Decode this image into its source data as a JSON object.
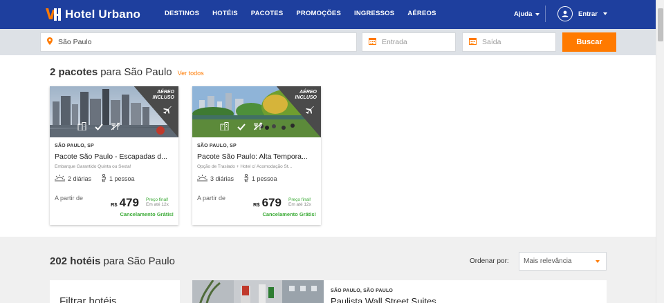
{
  "header": {
    "brand": "Hotel Urbano",
    "nav": [
      "DESTINOS",
      "HOTÉIS",
      "PACOTES",
      "PROMOÇÕES",
      "INGRESSOS",
      "AÉREOS"
    ],
    "help_label": "Ajuda",
    "login_label": "Entrar",
    "bg_color": "#1e3f9e"
  },
  "search": {
    "destination_value": "São Paulo",
    "checkin_placeholder": "Entrada",
    "checkout_placeholder": "Saída",
    "button_label": "Buscar",
    "accent_color": "#ff7a00"
  },
  "packages": {
    "count": "2 pacotes",
    "title_suffix": "para São Paulo",
    "see_all": "Ver todos",
    "items": [
      {
        "badge": [
          "AÉREO",
          "INCLUSO"
        ],
        "location": "SÃO PAULO, SP",
        "name": "Pacote São Paulo - Escapadas d...",
        "subtitle": "Embarque Garantido Quinta ou Sexta!",
        "nights": "2 diárias",
        "people": "1 pessoa",
        "from_label": "A partir de",
        "currency": "R$",
        "price": "479",
        "final_price_label": "Preço final!",
        "installments": "Em até 12x",
        "cancel_label": "Cancelamento Grátis!"
      },
      {
        "badge": [
          "AÉREO",
          "INCLUSO"
        ],
        "location": "SÃO PAULO, SP",
        "name": "Pacote São Paulo: Alta Tempora...",
        "subtitle": "Opção de Traslado + Hotel c/ Acomodação St...",
        "nights": "3 diárias",
        "people": "1 pessoa",
        "from_label": "A partir de",
        "currency": "R$",
        "price": "679",
        "final_price_label": "Preço final!",
        "installments": "Em até 12x",
        "cancel_label": "Cancelamento Grátis!"
      }
    ]
  },
  "hotels": {
    "count": "202 hotéis",
    "title_suffix": "para São Paulo",
    "sort_label": "Ordenar por:",
    "sort_value": "Mais relevância",
    "filter_title": "Filtrar hotéis",
    "first": {
      "location": "SÃO PAULO, SÃO PAULO",
      "name": "Paulista Wall Street Suites"
    }
  },
  "icons": [
    "logo-icon",
    "caret-down-icon",
    "user-icon",
    "map-pin-icon",
    "calendar-icon",
    "plane-icon",
    "building-icon",
    "check-icon",
    "no-food-icon",
    "sun-icon",
    "person-icon"
  ]
}
